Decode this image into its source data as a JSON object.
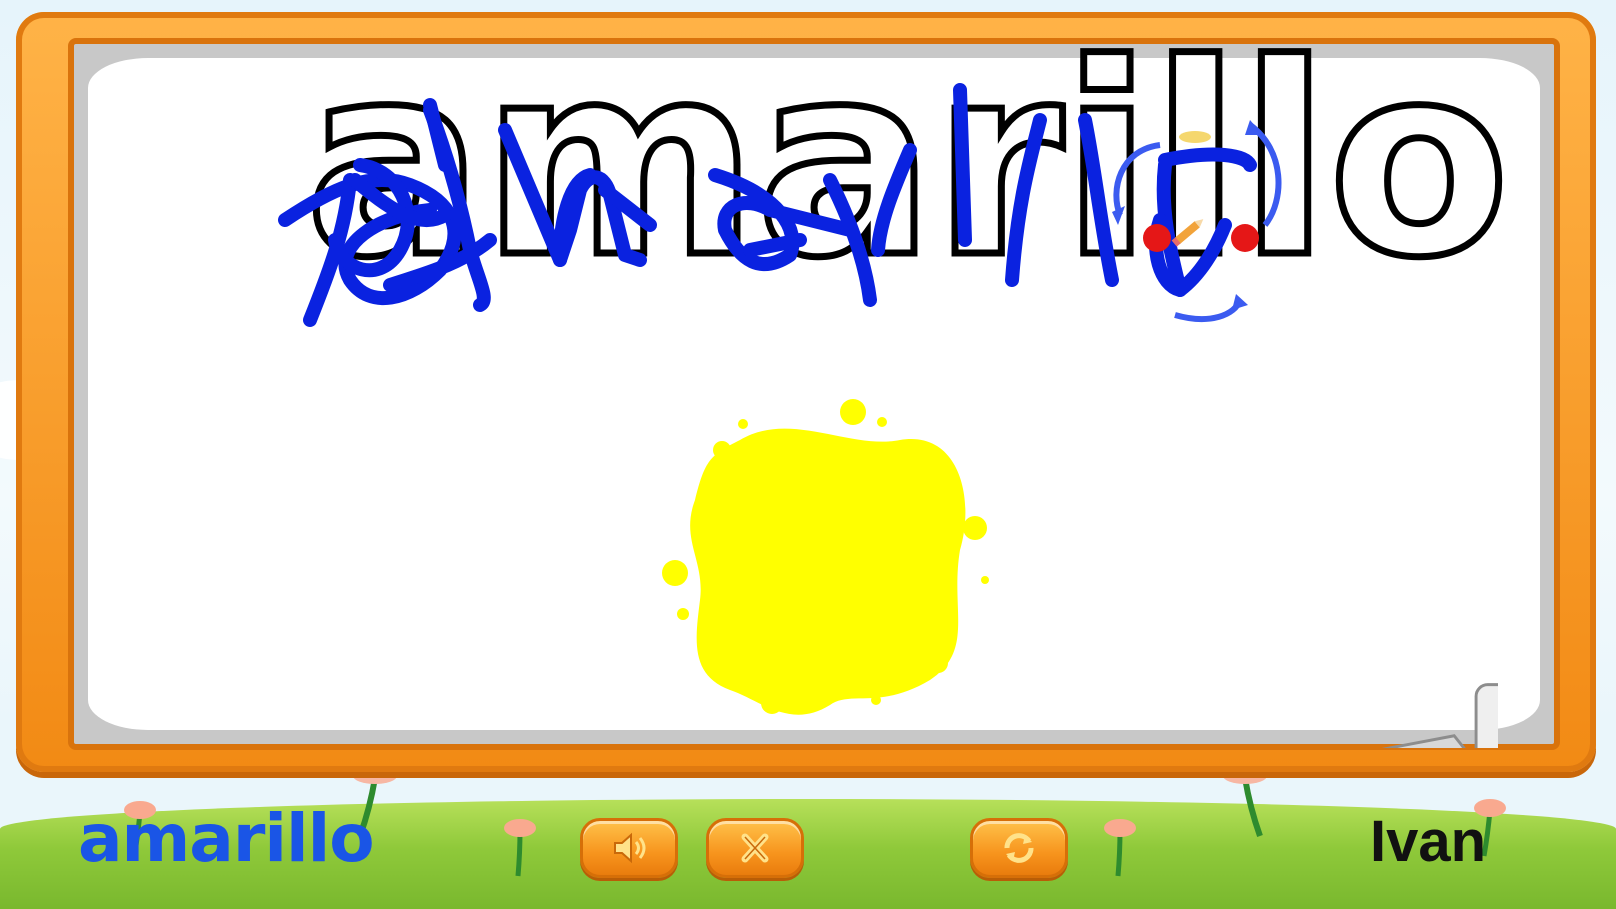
{
  "board": {
    "target_word": "amarillo"
  },
  "footer": {
    "color_word": "amarillo",
    "player_name": "Ivan",
    "buttons": [
      {
        "name": "sound-button",
        "icon": "speaker-icon"
      },
      {
        "name": "close-button",
        "icon": "close-x-icon"
      },
      {
        "name": "restart-button",
        "icon": "refresh-icon"
      }
    ]
  },
  "colors": {
    "frame": "#f7941d",
    "ink": "#0a22e0",
    "paint_splat": "#ffff00",
    "color_word": "#1a55e6"
  }
}
